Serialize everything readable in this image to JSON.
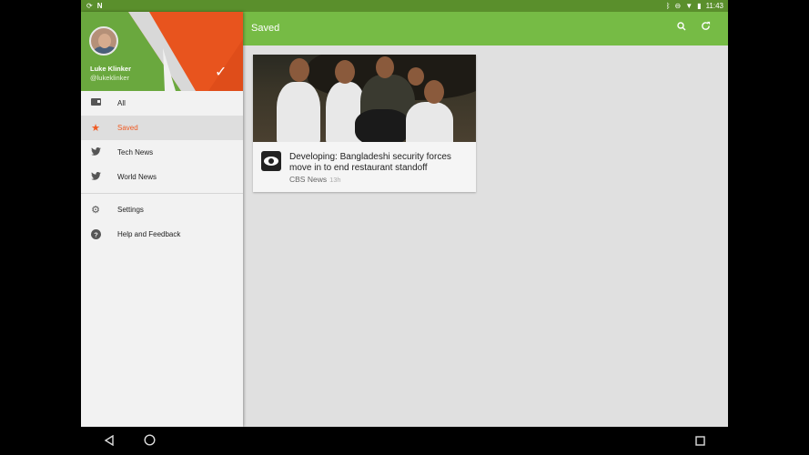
{
  "status_bar": {
    "left_icons": [
      "sync-icon",
      "notification-n-icon"
    ],
    "right_icons": [
      "bluetooth-icon",
      "do-not-disturb-icon",
      "wifi-icon",
      "battery-icon"
    ],
    "time": "11:43"
  },
  "toolbar": {
    "title": "Saved",
    "actions": [
      "search-icon",
      "refresh-icon"
    ]
  },
  "drawer": {
    "user": {
      "name": "Luke Klinker",
      "handle": "@lukeklinker"
    },
    "items": [
      {
        "label": "All",
        "icon": "feed-icon",
        "active": false
      },
      {
        "label": "Saved",
        "icon": "star-icon",
        "active": true
      },
      {
        "label": "Tech News",
        "icon": "twitter-icon",
        "active": false
      },
      {
        "label": "World News",
        "icon": "twitter-icon",
        "active": false
      }
    ],
    "secondary_items": [
      {
        "label": "Settings",
        "icon": "gear-icon"
      },
      {
        "label": "Help and Feedback",
        "icon": "help-icon"
      }
    ]
  },
  "articles": [
    {
      "headline": "Developing: Bangladeshi security forces move in to end restaurant standoff",
      "source": "CBS News",
      "age": "13h"
    }
  ],
  "colors": {
    "toolbar": "#76bb45",
    "status_bar": "#5a8f2c",
    "accent": "#f05a22"
  },
  "system_nav": [
    "back-icon",
    "home-icon",
    "recents-icon"
  ]
}
